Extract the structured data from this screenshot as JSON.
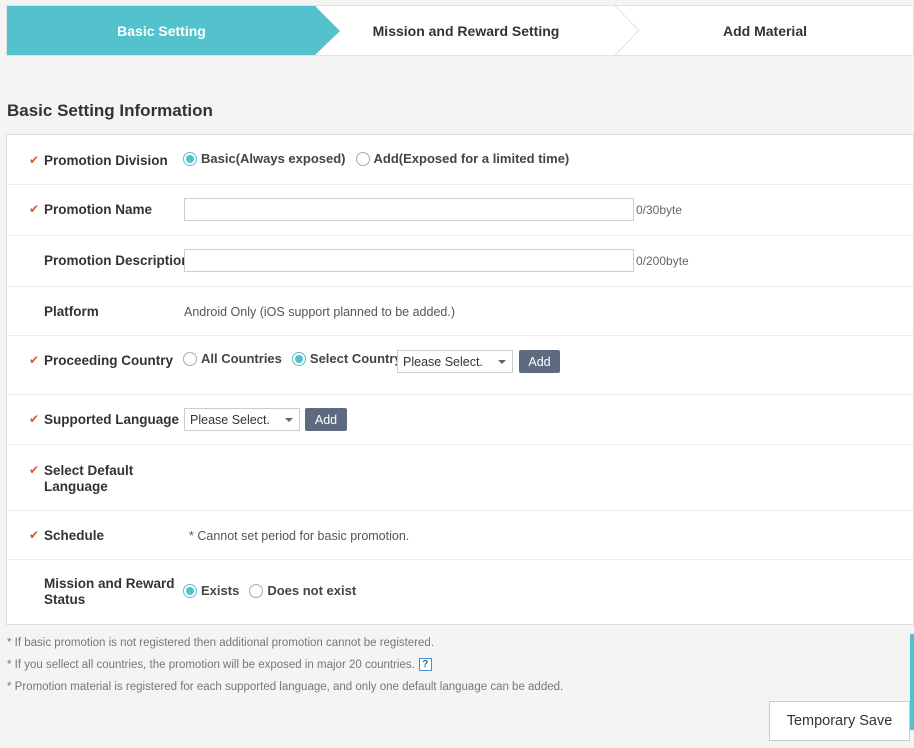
{
  "steps": [
    {
      "label": "Basic Setting"
    },
    {
      "label": "Mission and Reward Setting"
    },
    {
      "label": "Add Material"
    }
  ],
  "section_title": "Basic Setting Information",
  "form": {
    "promotion_division": {
      "label": "Promotion Division",
      "options": [
        "Basic(Always exposed)",
        "Add(Exposed for a limited time)"
      ],
      "selected": "Basic(Always exposed)"
    },
    "promotion_name": {
      "label": "Promotion Name",
      "value": "",
      "counter": "0/30byte"
    },
    "promotion_description": {
      "label": "Promotion Description",
      "value": "",
      "counter": "0/200byte"
    },
    "platform": {
      "label": "Platform",
      "value": "Android Only (iOS support planned to be added.)"
    },
    "proceeding_country": {
      "label": "Proceeding Country",
      "options": [
        "All Countries",
        "Select Country"
      ],
      "selected": "Select Country",
      "select_value": "Please Select.",
      "add_label": "Add"
    },
    "supported_language": {
      "label": "Supported Language",
      "select_value": "Please Select.",
      "add_label": "Add"
    },
    "default_language": {
      "label_line1": "Select Default",
      "label_line2": "Language"
    },
    "schedule": {
      "label": "Schedule",
      "note": "* Cannot set period for basic promotion."
    },
    "mission_reward_status": {
      "label_line1": "Mission and Reward",
      "label_line2": "Status",
      "options": [
        "Exists",
        "Does not exist"
      ],
      "selected": "Exists"
    }
  },
  "notes": [
    "* If basic promotion is not registered then additional promotion cannot be registered.",
    "* If you sellect all countries, the promotion will be exposed in major 20 countries.",
    "* Promotion material is registered for each supported language, and only one default language can be added."
  ],
  "help_icon_glyph": "?",
  "temporary_save_label": "Temporary Save",
  "colors": {
    "accent": "#53c2cc",
    "required_mark": "#e0522a",
    "add_button": "#5e6a80"
  }
}
